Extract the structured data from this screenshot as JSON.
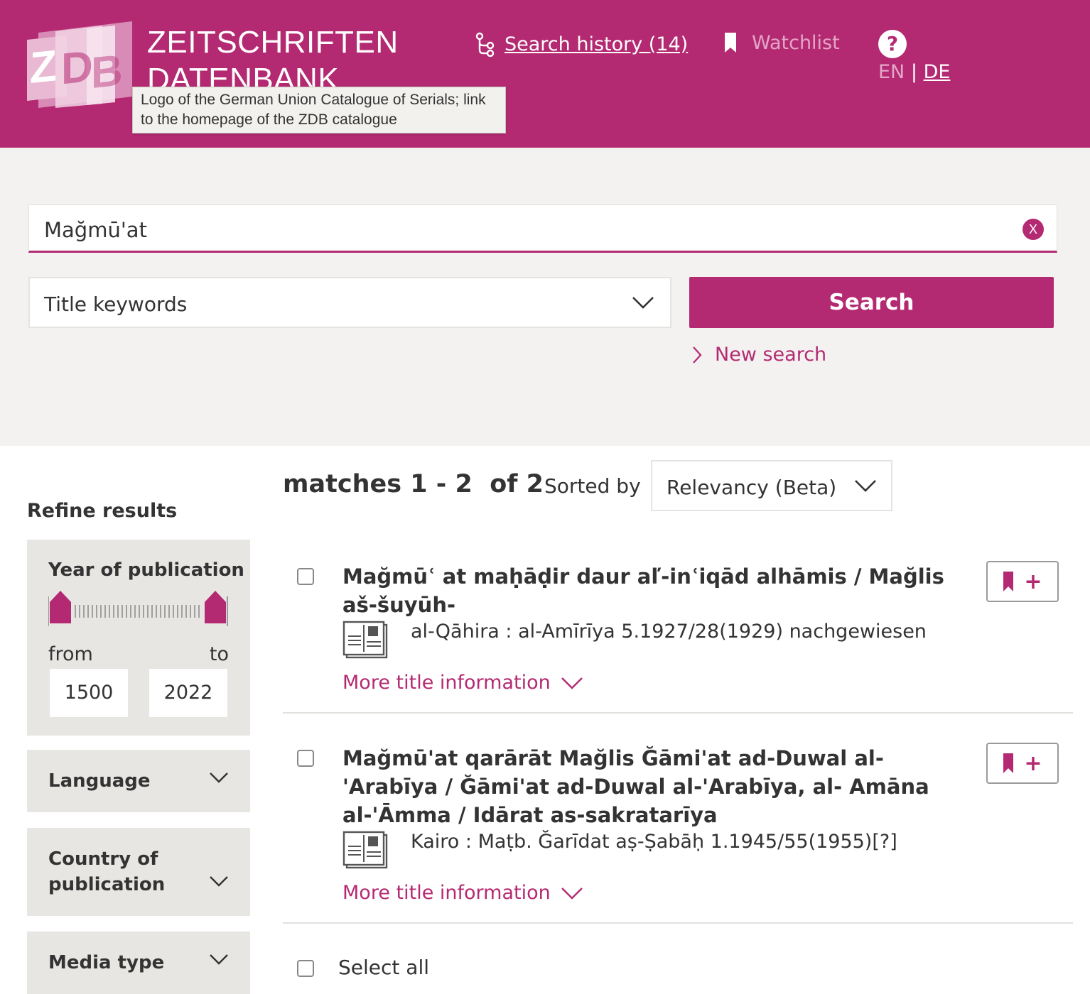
{
  "header": {
    "brand_line1": "ZEITSCHRIFTEN",
    "brand_line2": "DATENBANK",
    "logo_tooltip": "Logo of the German Union Catalogue of Serials; link to the homepage of the ZDB catalogue",
    "search_history": "Search history (14)",
    "watchlist": "Watchlist",
    "help": "?",
    "lang_en": "EN",
    "lang_sep": "|",
    "lang_de": "DE",
    "colors": {
      "brand": "#b42a72",
      "muted": "#e3a5c8"
    }
  },
  "search": {
    "query": "Mağmū'at",
    "clear": "X",
    "field": "Title keywords",
    "button": "Search",
    "new_search": "New search"
  },
  "results_header": {
    "matches": "matches 1 - 2  of 2",
    "sorted_by": "Sorted by",
    "sort_value": "Relevancy (Beta)"
  },
  "sidebar": {
    "refine": "Refine results",
    "year": {
      "title": "Year of publication",
      "from_label": "from",
      "to_label": "to",
      "from": "1500",
      "to": "2022"
    },
    "facets": [
      "Language",
      "Country of publication",
      "Media type"
    ]
  },
  "results": [
    {
      "title": "Mağmūʿ at maḥāḍir daur aľ-inʿiqād alhāmis / Mağlis aš-šuyūh-",
      "publication": "al-Qāhira : al-Amīrīya 5.1927/28(1929) nachgewiesen",
      "more": "More title information",
      "icon": "newspaper-icon"
    },
    {
      "title": "Mağmū'at qarārāt Mağlis Ğāmi'at ad-Duwal al-'Arabīya / Ğāmi'at ad-Duwal al-'Arabīya, al- Amāna al-'Āmma / Idārat as-sakratarīya",
      "publication": "Kairo : Maṭb. Ğarīdat aṣ-Ṣabāḥ 1.1945/55(1955)[?]",
      "more": "More title information",
      "icon": "newspaper-icon"
    }
  ],
  "select_all": "Select all"
}
